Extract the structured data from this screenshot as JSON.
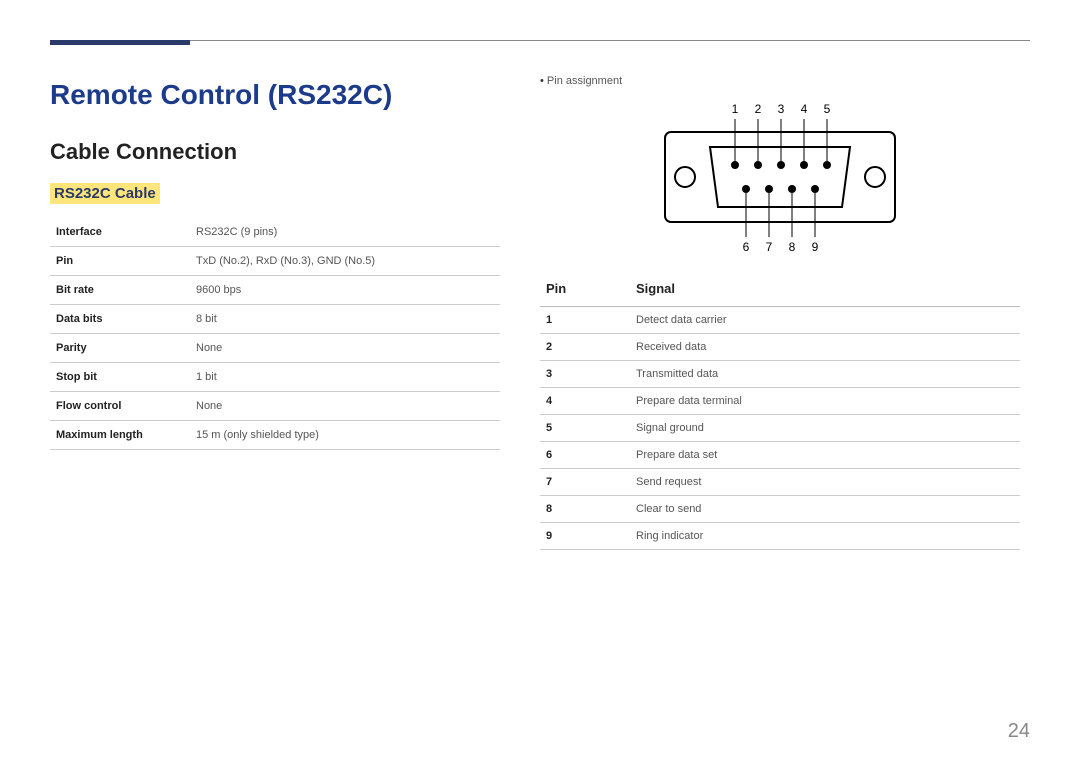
{
  "title": "Remote Control (RS232C)",
  "subtitle": "Cable Connection",
  "section_heading": "RS232C Cable",
  "specs": [
    {
      "label": "Interface",
      "value": "RS232C (9 pins)"
    },
    {
      "label": "Pin",
      "value": "TxD (No.2), RxD (No.3), GND (No.5)"
    },
    {
      "label": "Bit rate",
      "value": "9600 bps"
    },
    {
      "label": "Data bits",
      "value": "8 bit"
    },
    {
      "label": "Parity",
      "value": "None"
    },
    {
      "label": "Stop bit",
      "value": "1 bit"
    },
    {
      "label": "Flow control",
      "value": "None"
    },
    {
      "label": "Maximum length",
      "value": "15 m (only shielded type)"
    }
  ],
  "pin_note": "Pin assignment",
  "pin_table": {
    "header_pin": "Pin",
    "header_signal": "Signal",
    "rows": [
      {
        "pin": "1",
        "signal": "Detect data carrier"
      },
      {
        "pin": "2",
        "signal": "Received data"
      },
      {
        "pin": "3",
        "signal": "Transmitted data"
      },
      {
        "pin": "4",
        "signal": "Prepare data terminal"
      },
      {
        "pin": "5",
        "signal": "Signal ground"
      },
      {
        "pin": "6",
        "signal": "Prepare data set"
      },
      {
        "pin": "7",
        "signal": "Send request"
      },
      {
        "pin": "8",
        "signal": "Clear to send"
      },
      {
        "pin": "9",
        "signal": "Ring indicator"
      }
    ]
  },
  "diagram_labels": {
    "top": [
      "1",
      "2",
      "3",
      "4",
      "5"
    ],
    "bottom": [
      "6",
      "7",
      "8",
      "9"
    ]
  },
  "page_number": "24"
}
